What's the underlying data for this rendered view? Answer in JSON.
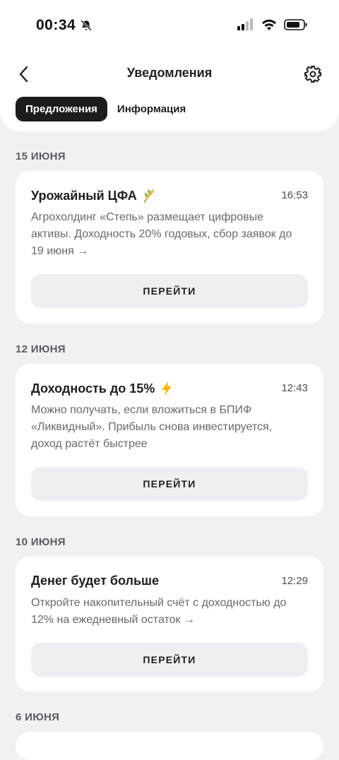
{
  "status_bar": {
    "time": "00:34",
    "icons": [
      "bell-slash-icon",
      "signal-icon",
      "wifi-icon",
      "battery-icon"
    ]
  },
  "header": {
    "title": "Уведомления",
    "back_icon": "chevron-left-icon",
    "settings_icon": "gear-icon"
  },
  "tabs": [
    {
      "label": "Предложения",
      "active": true
    },
    {
      "label": "Информация",
      "active": false
    }
  ],
  "groups": [
    {
      "date": "15 ИЮНЯ",
      "card": {
        "title": "Урожайный ЦФА",
        "emoji": "wheat-icon",
        "time": "16:53",
        "text": "Агрохолдинг «Степь» размещает цифровые активы. Доходность 20% годовых, сбор заявок до 19 июня →",
        "button": "ПЕРЕЙТИ"
      }
    },
    {
      "date": "12 ИЮНЯ",
      "card": {
        "title": "Доходность до 15%",
        "emoji": "lightning-icon",
        "time": "12:43",
        "text": "Можно получать, если вложиться в БПИФ «Ликвидный». Прибыль снова инвестируется, доход растёт быстрее",
        "button": "ПЕРЕЙТИ"
      }
    },
    {
      "date": "10 ИЮНЯ",
      "card": {
        "title": "Денег будет больше",
        "emoji": "",
        "time": "12:29",
        "text": "Откройте накопительный счёт с доходностью до 12% на ежедневный остаток →",
        "button": "ПЕРЕЙТИ"
      }
    },
    {
      "date": "6 ИЮНЯ"
    }
  ],
  "colors": {
    "background": "#f1f1f4",
    "active_tab": "#1c1c1f",
    "button_bg": "#efeff3",
    "accent_yellow": "#f5b800"
  }
}
